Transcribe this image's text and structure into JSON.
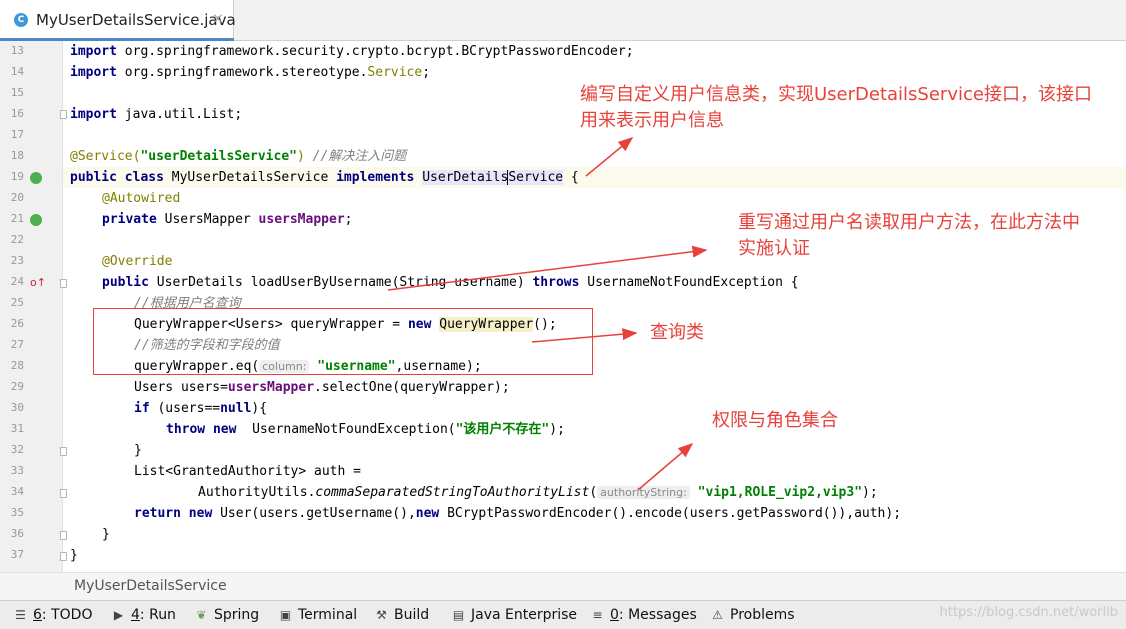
{
  "tab": {
    "title": "MyUserDetailsService.java",
    "icon": "java-class-icon",
    "close": "×"
  },
  "lines": [
    {
      "n": "13"
    },
    {
      "n": "14"
    },
    {
      "n": "15"
    },
    {
      "n": "16"
    },
    {
      "n": "17"
    },
    {
      "n": "18"
    },
    {
      "n": "19"
    },
    {
      "n": "20"
    },
    {
      "n": "21"
    },
    {
      "n": "22"
    },
    {
      "n": "23"
    },
    {
      "n": "24"
    },
    {
      "n": "25"
    },
    {
      "n": "26"
    },
    {
      "n": "27"
    },
    {
      "n": "28"
    },
    {
      "n": "29"
    },
    {
      "n": "30"
    },
    {
      "n": "31"
    },
    {
      "n": "32"
    },
    {
      "n": "33"
    },
    {
      "n": "34"
    },
    {
      "n": "35"
    },
    {
      "n": "36"
    },
    {
      "n": "37"
    }
  ],
  "code": {
    "l13": {
      "kw": "import",
      "rest": " org.springframework.security.crypto.bcrypt.BCryptPasswordEncoder;"
    },
    "l14": {
      "kw": "import",
      "rest": " org.springframework.stereotype.",
      "ann": "Service",
      ";": ";"
    },
    "l16": {
      "kw": "import",
      "rest": " java.util.List;"
    },
    "l18": {
      "ann": "@Service(",
      "str": "\"userDetailsService\"",
      "close": ")",
      "cm": " //解决注入问题"
    },
    "l19": {
      "kw1": "public class",
      "mid": " MyUserDetailsService ",
      "kw2": "implements",
      "sp": " ",
      "hl_a": "UserDetails",
      "hl_b": "Service",
      "end": " {"
    },
    "l20": {
      "ann": "@Autowired"
    },
    "l21": {
      "kw": "private",
      "mid": " UsersMapper ",
      "fld": "usersMapper",
      ";": ";"
    },
    "l23": {
      "ann": "@Override"
    },
    "l24": {
      "kw": "public",
      "mid": " UserDetails loadUserByUsername(String username) ",
      "kw2": "throws",
      "end": " UsernameNotFoundException {"
    },
    "l25": {
      "cm": "//根据用户名查询"
    },
    "l26": {
      "pre": "QueryWrapper<Users> queryWrapper = ",
      "kw": "new",
      "sp": " ",
      "hl": "QueryWrapper",
      "end": "();"
    },
    "l27": {
      "cm": "//筛选的字段和字段的值"
    },
    "l28": {
      "pre": "queryWrapper.eq(",
      "hint": "column:",
      "str": "\"username\"",
      "end": ",username);"
    },
    "l29": {
      "pre": "Users users=",
      "fld": "usersMapper",
      "end": ".selectOne(queryWrapper);"
    },
    "l30": {
      "kw": "if",
      "mid": " (users==",
      "kw2": "null",
      "end": "){"
    },
    "l31": {
      "kw": "throw new",
      "mid": "  UsernameNotFoundException(",
      "str": "\"该用户不存在\"",
      "end": ");"
    },
    "l32": {
      "t": "}"
    },
    "l33": {
      "t": "List<GrantedAuthority> auth ="
    },
    "l34": {
      "pre": "AuthorityUtils.",
      "it": "commaSeparatedStringToAuthorityList",
      "open": "(",
      "hint": "authorityString:",
      "str": "\"vip1,ROLE_vip2,vip3\"",
      "end": ");"
    },
    "l35": {
      "kw": "return new",
      "mid": " User(users.getUsername(),",
      "kw2": "new",
      "end": " BCryptPasswordEncoder().encode(users.getPassword()),auth);"
    },
    "l36": {
      "t": "}"
    },
    "l37": {
      "t": "}"
    }
  },
  "notes": {
    "n1_line1": "编写自定义用户信息类，实现UserDetailsService接口，该接口",
    "n1_line2": "用来表示用户信息",
    "n2_line1": "重写通过用户名读取用户方法，在此方法中",
    "n2_line2": "实施认证",
    "n3": "查询类",
    "n4": "权限与角色集合"
  },
  "breadcrumb": "MyUserDetailsService",
  "toolwindows": [
    {
      "key": "6",
      "label": ": TODO",
      "icon": "todo-list-icon"
    },
    {
      "key": "4",
      "label": ": Run",
      "icon": "run-play-icon"
    },
    {
      "key": "",
      "label": "Spring",
      "icon": "spring-leaf-icon"
    },
    {
      "key": "",
      "label": "Terminal",
      "icon": "terminal-icon"
    },
    {
      "key": "",
      "label": "Build",
      "icon": "hammer-icon"
    },
    {
      "key": "",
      "label": "Java Enterprise",
      "icon": "java-enterprise-icon"
    },
    {
      "key": "0",
      "label": ": Messages",
      "icon": "messages-icon"
    },
    {
      "key": "",
      "label": "Problems",
      "icon": "warning-icon"
    }
  ],
  "watermark": "https://blog.csdn.net/worlib",
  "colors": {
    "accent": "#4a88c7",
    "annotation": "#e8413b",
    "keyword": "#000080",
    "string": "#008000",
    "annotation_code": "#808000",
    "comment": "#808080",
    "field": "#660e7a"
  }
}
